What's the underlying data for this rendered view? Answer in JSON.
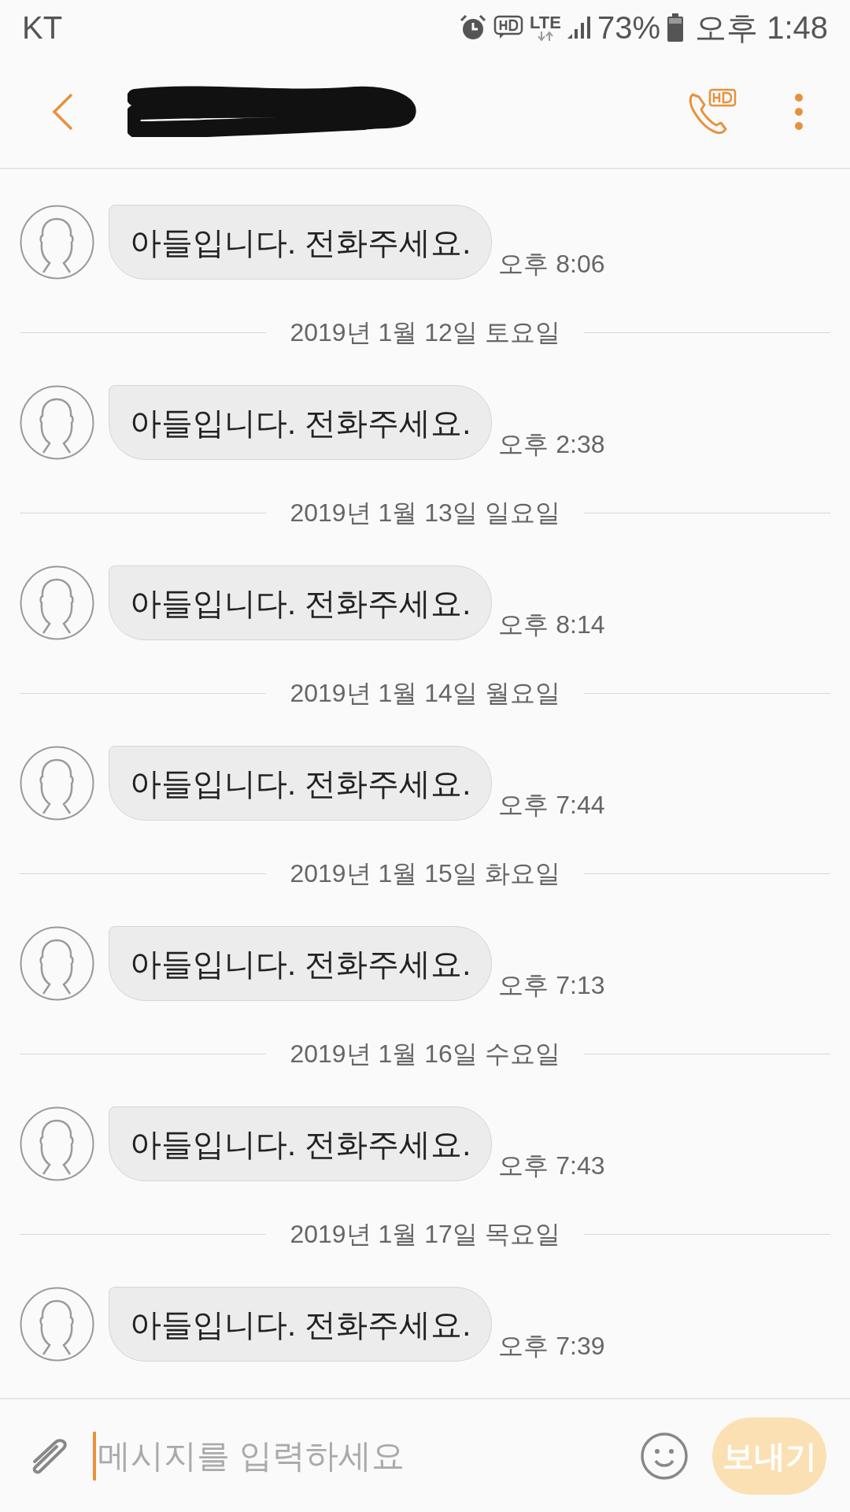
{
  "status_bar": {
    "carrier": "KT",
    "network": "LTE",
    "battery": "73%",
    "time": "오후 1:48"
  },
  "thread": [
    {
      "kind": "message",
      "text": "아들입니다. 전화주세요.",
      "time": "오후 8:06"
    },
    {
      "kind": "date",
      "text": "2019년 1월 12일 토요일"
    },
    {
      "kind": "message",
      "text": "아들입니다. 전화주세요.",
      "time": "오후 2:38"
    },
    {
      "kind": "date",
      "text": "2019년 1월 13일 일요일"
    },
    {
      "kind": "message",
      "text": "아들입니다. 전화주세요.",
      "time": "오후 8:14"
    },
    {
      "kind": "date",
      "text": "2019년 1월 14일 월요일"
    },
    {
      "kind": "message",
      "text": "아들입니다. 전화주세요.",
      "time": "오후 7:44"
    },
    {
      "kind": "date",
      "text": "2019년 1월 15일 화요일"
    },
    {
      "kind": "message",
      "text": "아들입니다. 전화주세요.",
      "time": "오후 7:13"
    },
    {
      "kind": "date",
      "text": "2019년 1월 16일 수요일"
    },
    {
      "kind": "message",
      "text": "아들입니다. 전화주세요.",
      "time": "오후 7:43"
    },
    {
      "kind": "date",
      "text": "2019년 1월 17일 목요일"
    },
    {
      "kind": "message",
      "text": "아들입니다. 전화주세요.",
      "time": "오후 7:39"
    }
  ],
  "composer": {
    "placeholder": "메시지를 입력하세요",
    "send": "보내기"
  }
}
